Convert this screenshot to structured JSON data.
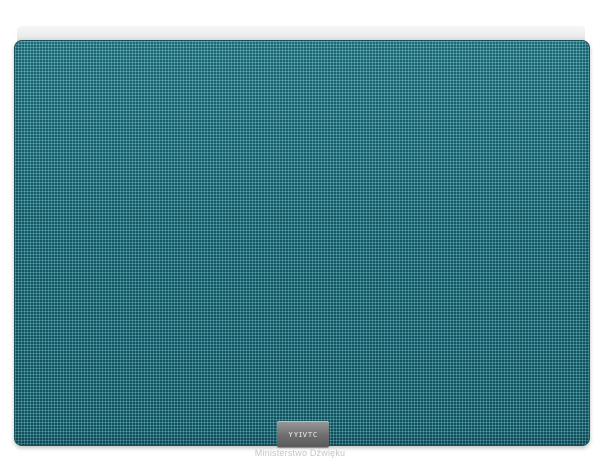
{
  "product": {
    "badge_text": "ʏʏɪᴠᴛᴄ",
    "grille_color": "#1f6b78",
    "cabinet_color": "#ececec",
    "badge_color": "#6e6e6e"
  },
  "watermark": {
    "text": "Ministerstwo Dźwięku"
  }
}
